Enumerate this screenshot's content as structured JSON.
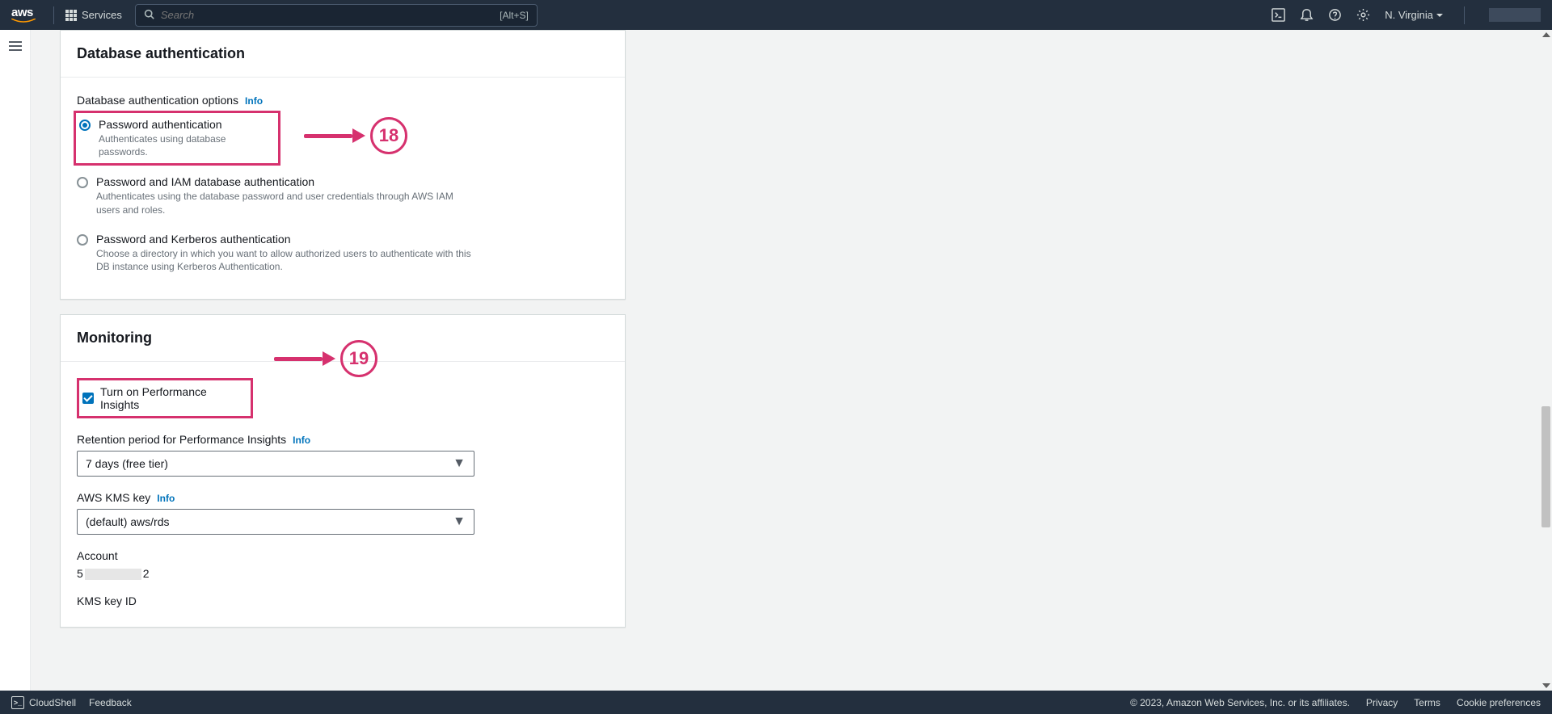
{
  "nav": {
    "logo": "aws",
    "services": "Services",
    "search_placeholder": "Search",
    "search_shortcut": "[Alt+S]",
    "region": "N. Virginia"
  },
  "auth_panel": {
    "title": "Database authentication",
    "options_label": "Database authentication options",
    "info": "Info",
    "options": [
      {
        "label": "Password authentication",
        "desc": "Authenticates using database passwords.",
        "checked": true
      },
      {
        "label": "Password and IAM database authentication",
        "desc": "Authenticates using the database password and user credentials through AWS IAM users and roles.",
        "checked": false
      },
      {
        "label": "Password and Kerberos authentication",
        "desc": "Choose a directory in which you want to allow authorized users to authenticate with this DB instance using Kerberos Authentication.",
        "checked": false
      }
    ]
  },
  "monitoring_panel": {
    "title": "Monitoring",
    "perf_insights_label": "Turn on Performance Insights",
    "retention_label": "Retention period for Performance Insights",
    "retention_info": "Info",
    "retention_value": "7 days (free tier)",
    "kms_label": "AWS KMS key",
    "kms_info": "Info",
    "kms_value": "(default) aws/rds",
    "account_label": "Account",
    "account_prefix": "5",
    "account_suffix": "2",
    "kms_id_label": "KMS key ID"
  },
  "annotations": {
    "a18": "18",
    "a19": "19"
  },
  "footer": {
    "cloudshell": "CloudShell",
    "feedback": "Feedback",
    "copyright": "© 2023, Amazon Web Services, Inc. or its affiliates.",
    "privacy": "Privacy",
    "terms": "Terms",
    "cookie": "Cookie preferences"
  }
}
